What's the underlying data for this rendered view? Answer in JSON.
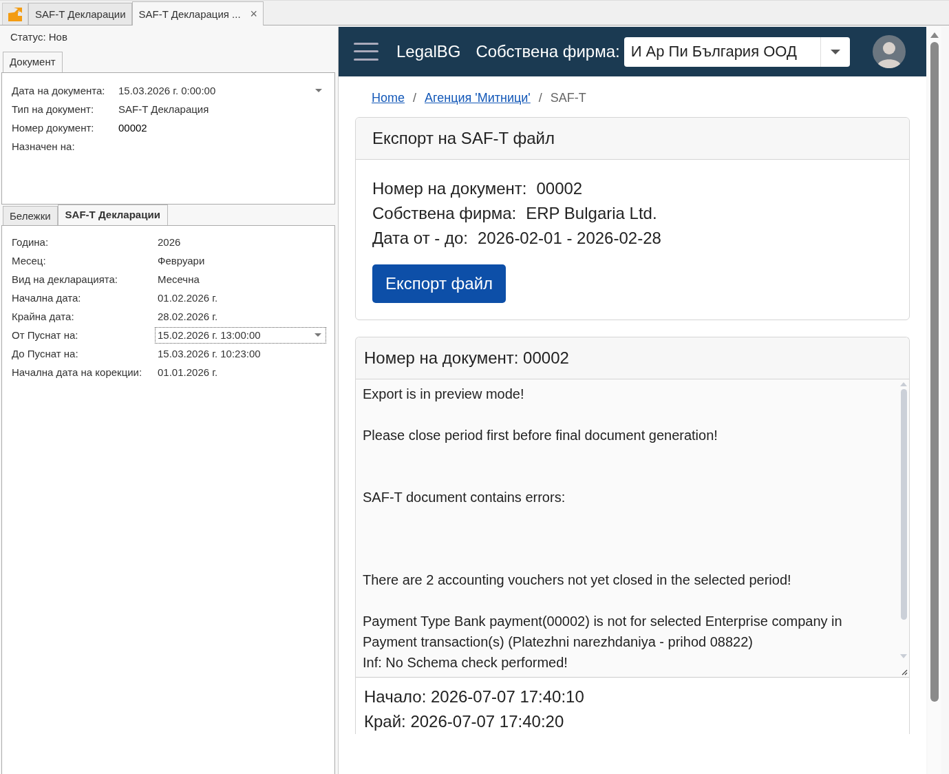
{
  "app_tabs": [
    {
      "label": "SAF-T Декларации",
      "selected": false
    },
    {
      "label": "SAF-T Декларация ...",
      "selected": true,
      "close": "×"
    }
  ],
  "status": "Статус: Нов",
  "document_panel": {
    "tab": "Документ",
    "fields": [
      {
        "label": "Дата на документа:",
        "value": "15.03.2026 г. 0:00:00",
        "kind": "dropdown"
      },
      {
        "label": "Тип на документ:",
        "value": "SAF-T Декларация",
        "kind": "text"
      },
      {
        "label": "Номер документ:",
        "value": "00002",
        "kind": "strong"
      },
      {
        "label": "Назначен на:",
        "kind": "text"
      }
    ]
  },
  "detail_tabs": [
    {
      "label": "Бележки",
      "selected": false
    },
    {
      "label": "SAF-T Декларации",
      "selected": true
    }
  ],
  "detail_fields": [
    {
      "label": "Година:",
      "value": "2026",
      "kind": "text"
    },
    {
      "label": "Месец:",
      "value": "Февруари",
      "kind": "text"
    },
    {
      "label": "Вид на декларацията:",
      "value": "Месечна",
      "kind": "text"
    },
    {
      "label": "Начална дата:",
      "value": "01.02.2026 г.",
      "kind": "text"
    },
    {
      "label": "Крайна дата:",
      "value": "28.02.2026 г.",
      "kind": "text"
    },
    {
      "label": "От Пуснат на:",
      "value": "15.02.2026 г. 13:00:00",
      "kind": "dropdown"
    },
    {
      "label": "До Пуснат на:",
      "value": "15.03.2026 г. 10:23:00",
      "kind": "text"
    },
    {
      "label": "Начална дата на корекции:",
      "value": "01.01.2026 г.",
      "kind": "text"
    }
  ],
  "web": {
    "brand": "LegalBG",
    "company_label": "Собствена фирма:",
    "company_value": "И Ар Пи България ООД",
    "breadcrumb_separator": "/",
    "breadcrumbs": [
      {
        "label": "Home",
        "kind": "link"
      },
      {
        "label": "Агенция 'Митници'",
        "kind": "link"
      },
      {
        "label": "SAF-T",
        "kind": "current"
      }
    ],
    "export_card": {
      "title": "Експорт на SAF-T файл",
      "lines": [
        {
          "label": "Номер на документ:",
          "value": "00002"
        },
        {
          "label": "Собствена фирма:",
          "value": "ERP Bulgaria Ltd."
        },
        {
          "label": "Дата от - до:",
          "value": "2026-02-01 - 2026-02-28"
        }
      ],
      "button": "Експорт файл"
    },
    "result_card": {
      "title": "Номер на документ: 00002",
      "messages": [
        {
          "lines": [
            "Export is in preview mode!"
          ]
        },
        {
          "lines": [
            "Please close period first before final document generation!"
          ]
        },
        {
          "lines": [
            "SAF-T document contains errors:"
          ]
        },
        {
          "lines": [
            "There are 2 accounting vouchers not yet closed in the selected period!"
          ]
        },
        {
          "lines": [
            "Payment Type Bank payment(00002) is not for selected Enterprise company in",
            "Payment transaction(s) (Platezhni narezhdaniya - prihod 08822)",
            "Inf: No Schema check performed!"
          ]
        }
      ],
      "start": "Начало: 2026-07-07 17:40:10",
      "end": "Край: 2026-07-07 17:40:20"
    }
  }
}
